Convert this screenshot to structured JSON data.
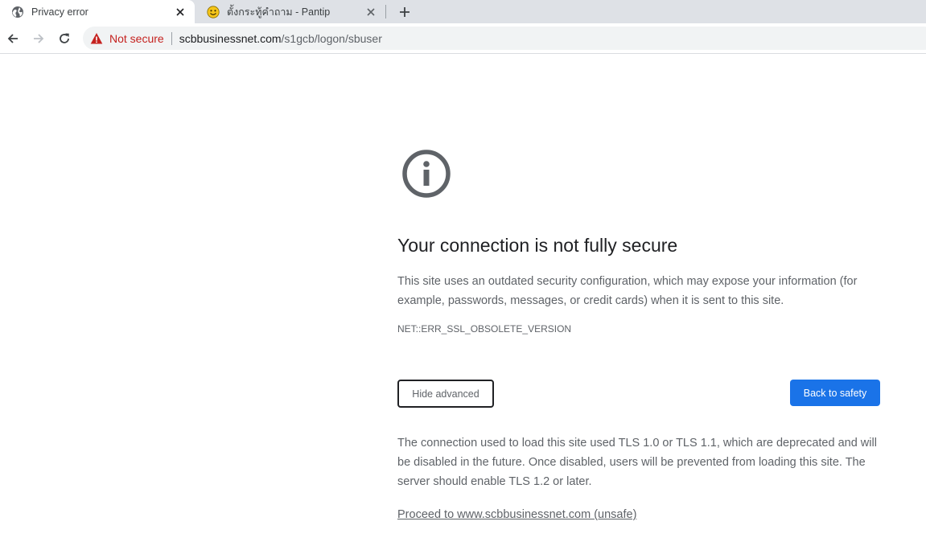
{
  "browser": {
    "tabs": [
      {
        "title": "Privacy error",
        "favicon": "globe-icon",
        "active": true
      },
      {
        "title": "ตั้งกระทู้คำถาม - Pantip",
        "favicon": "pantip-emoji-icon",
        "active": false
      }
    ],
    "address_bar": {
      "security_label": "Not secure",
      "url_host": "scbbusinessnet.com",
      "url_path": "/s1gcb/logon/sbuser"
    }
  },
  "interstitial": {
    "heading": "Your connection is not fully secure",
    "explanation": "This site uses an outdated security configuration, which may expose your information (for example, passwords, messages, or credit cards) when it is sent to this site.",
    "error_code": "NET::ERR_SSL_OBSOLETE_VERSION",
    "hide_advanced_label": "Hide advanced",
    "back_to_safety_label": "Back to safety",
    "details": "The connection used to load this site used TLS 1.0 or TLS 1.1, which are deprecated and will be disabled in the future. Once disabled, users will be prevented from loading this site. The server should enable TLS 1.2 or later.",
    "proceed_link": "Proceed to www.scbbusinessnet.com (unsafe)"
  },
  "colors": {
    "accent": "#1a73e8",
    "not_secure": "#c5221f",
    "text_secondary": "#5f6368"
  }
}
